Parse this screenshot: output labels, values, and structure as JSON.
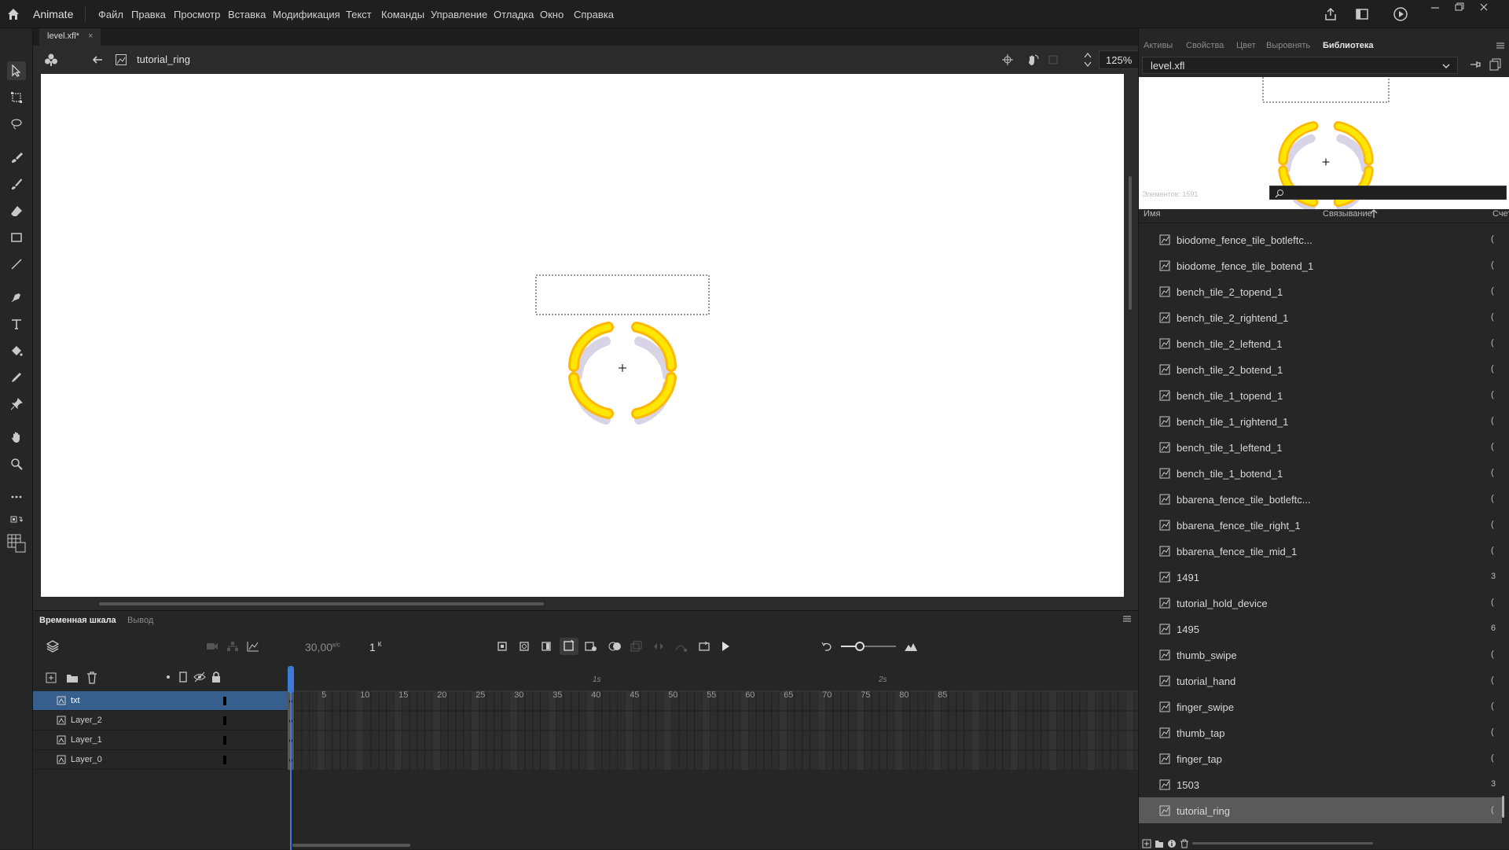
{
  "app": {
    "name": "Animate",
    "menu": [
      "Файл",
      "Правка",
      "Просмотр",
      "Вставка",
      "Модификация",
      "Текст",
      "Команды",
      "Управление",
      "Отладка",
      "Окно",
      "Справка"
    ]
  },
  "document": {
    "tab_label": "level.xfl*",
    "scene_name": "tutorial_ring",
    "zoom": "125%"
  },
  "timeline": {
    "tab_timeline": "Временная шкала",
    "tab_output": "Вывод",
    "fps": "30,00",
    "fps_unit": "к/с",
    "current_frame": "1",
    "frame_suffix": "К",
    "ruler": [
      "5",
      "10",
      "15",
      "20",
      "25",
      "30",
      "35",
      "40",
      "45",
      "50",
      "55",
      "60",
      "65",
      "70",
      "75",
      "80",
      "85"
    ],
    "seconds": [
      "1s",
      "2s"
    ],
    "layers": [
      {
        "name": "txt",
        "selected": true
      },
      {
        "name": "Layer_2",
        "selected": false
      },
      {
        "name": "Layer_1",
        "selected": false
      },
      {
        "name": "Layer_0",
        "selected": false
      }
    ]
  },
  "panel": {
    "tabs": [
      "Активы",
      "Свойства",
      "Цвет",
      "Выровнять",
      "Библиотека"
    ],
    "active_tab": "Библиотека",
    "library_file": "level.xfl",
    "items_count": "Элементов: 1591",
    "col_name": "Имя",
    "col_link": "Связывание",
    "col_count": "Счет",
    "items": [
      {
        "name": "biodome_fence_tile_botleftc...",
        "link": "("
      },
      {
        "name": "biodome_fence_tile_botend_1",
        "link": "("
      },
      {
        "name": "bench_tile_2_topend_1",
        "link": "("
      },
      {
        "name": "bench_tile_2_rightend_1",
        "link": "("
      },
      {
        "name": "bench_tile_2_leftend_1",
        "link": "("
      },
      {
        "name": "bench_tile_2_botend_1",
        "link": "("
      },
      {
        "name": "bench_tile_1_topend_1",
        "link": "("
      },
      {
        "name": "bench_tile_1_rightend_1",
        "link": "("
      },
      {
        "name": "bench_tile_1_leftend_1",
        "link": "("
      },
      {
        "name": "bench_tile_1_botend_1",
        "link": "("
      },
      {
        "name": "bbarena_fence_tile_botleftc...",
        "link": "("
      },
      {
        "name": "bbarena_fence_tile_right_1",
        "link": "("
      },
      {
        "name": "bbarena_fence_tile_mid_1",
        "link": "("
      },
      {
        "name": "1491",
        "link": "3"
      },
      {
        "name": "tutorial_hold_device",
        "link": "("
      },
      {
        "name": "1495",
        "link": "6"
      },
      {
        "name": "thumb_swipe",
        "link": "("
      },
      {
        "name": "tutorial_hand",
        "link": "("
      },
      {
        "name": "finger_swipe",
        "link": "("
      },
      {
        "name": "thumb_tap",
        "link": "("
      },
      {
        "name": "finger_tap",
        "link": "("
      },
      {
        "name": "1503",
        "link": "3"
      },
      {
        "name": "tutorial_ring",
        "link": "(",
        "selected": true
      }
    ]
  },
  "colors": {
    "accent": "#365f8e",
    "playhead": "#3d7bd6",
    "ring_yellow": "#ffd500",
    "ring_shadow": "#d8d4e6"
  }
}
